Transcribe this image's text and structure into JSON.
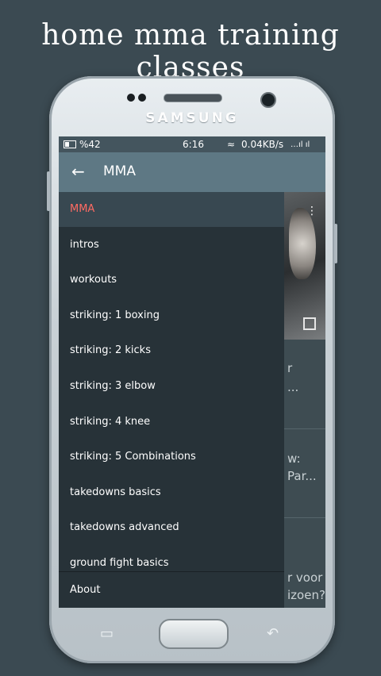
{
  "headline": "home mma training classes",
  "device": {
    "brand": "SAMSUNG"
  },
  "status_bar": {
    "battery": "%42",
    "time": "6:16",
    "network": "0.04KB/s",
    "signal": "…ıl ıl"
  },
  "app_bar": {
    "title": "MMA",
    "back_icon": "←"
  },
  "drawer": {
    "items": [
      {
        "label": "MMA"
      },
      {
        "label": "intros"
      },
      {
        "label": "workouts"
      },
      {
        "label": "striking: 1 boxing"
      },
      {
        "label": "striking: 2 kicks"
      },
      {
        "label": "striking: 3 elbow"
      },
      {
        "label": "striking: 4 knee"
      },
      {
        "label": "striking: 5 Combinations"
      },
      {
        "label": "takedowns basics"
      },
      {
        "label": "takedowns advanced"
      },
      {
        "label": "ground fight basics"
      }
    ],
    "active_index": 0,
    "footer_label": "About"
  },
  "background_content": {
    "fragments": [
      "r",
      "...",
      "w:",
      "Par...",
      "r voor",
      "izoen?"
    ]
  },
  "colors": {
    "accent": "#ff6b63",
    "app_bar": "#5e7884",
    "drawer": "#273238"
  }
}
